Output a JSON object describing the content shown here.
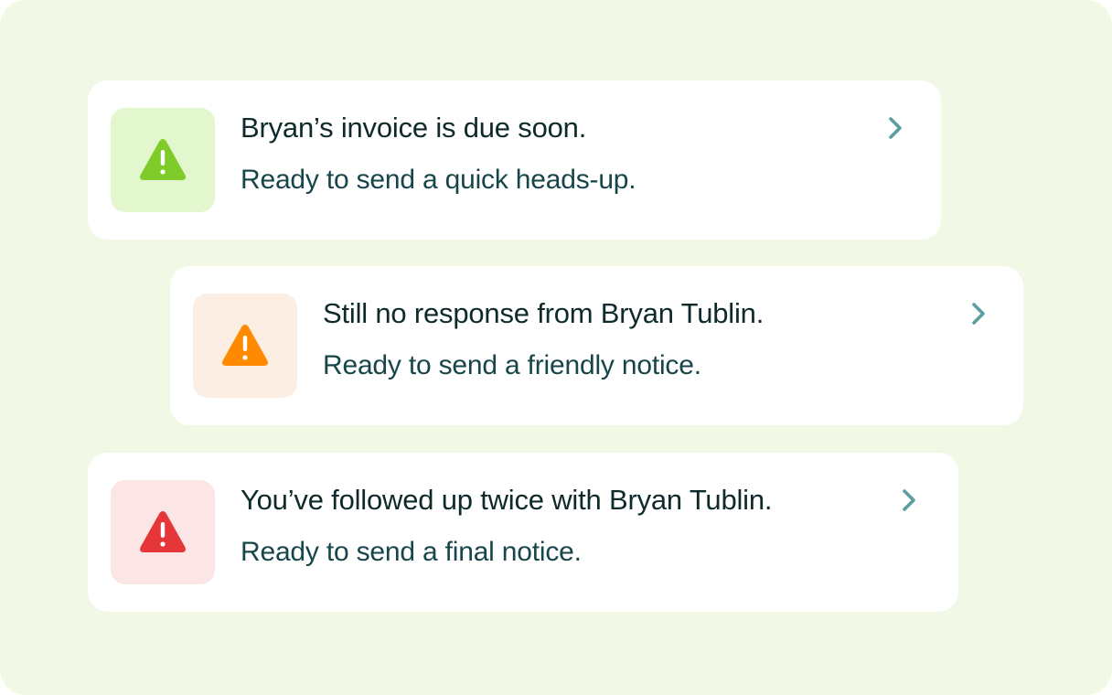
{
  "notifications": [
    {
      "title": "Bryan’s invoice is due soon.",
      "subtitle": "Ready to send a quick heads-up.",
      "severity": "low",
      "icon": "warning-triangle-icon",
      "icon_color": "#7fcb2a",
      "icon_bg": "#e3f7cf"
    },
    {
      "title": "Still no response from Bryan Tublin.",
      "subtitle": "Ready to send a friendly notice.",
      "severity": "medium",
      "icon": "warning-triangle-icon",
      "icon_color": "#ff8a00",
      "icon_bg": "#fdeee3"
    },
    {
      "title": "You’ve followed up twice with Bryan Tublin.",
      "subtitle": "Ready to send a final notice.",
      "severity": "high",
      "icon": "warning-triangle-icon",
      "icon_color": "#e5373a",
      "icon_bg": "#fbe5e5"
    }
  ],
  "chevron_color": "#5b9ea0",
  "chevron_icon": "chevron-right-icon"
}
